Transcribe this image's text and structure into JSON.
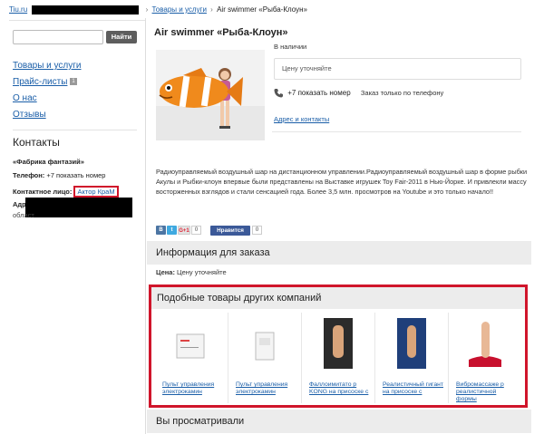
{
  "breadcrumb": {
    "home": "Tiu.ru",
    "category": "Товары и услуги",
    "current": "Air swimmer «Рыба-Клоун»",
    "separator": "›"
  },
  "sidebar": {
    "search": {
      "value": "",
      "placeholder": "",
      "button_label": "Найти"
    },
    "nav": [
      {
        "label": "Товары и услуги"
      },
      {
        "label": "Прайс-листы",
        "count": "1"
      },
      {
        "label": "О нас"
      },
      {
        "label": "Отзывы"
      }
    ],
    "contacts": {
      "title": "Контакты",
      "company": "«Фабрика фантазий»",
      "phone_label": "Телефон:",
      "phone_value": "+7 показать номер",
      "person_label": "Контактное лицо:",
      "person_value": "Актор КраМ",
      "address_label": "Адрес",
      "region": "област"
    }
  },
  "product": {
    "title": "Air swimmer «Рыба-Клоун»",
    "availability": "В наличии",
    "price": "Цену уточняйте",
    "phone": "+7 показать номер",
    "phone_note": "Заказ только по телефону",
    "address_link": "Адрес и контакты",
    "description": "Радиоуправляемый воздушный шар на дистанционном управлении.Радиоуправляемый воздушный шар в форме рыбки Акулы и Рыбки-клоун впервые были представлены на Выставке игрушек Toy Fair-2011 в Нью-Йорке. И привлекли массу восторженных взглядов и стали сенсацией года. Более 3,5 млн. просмотров на Youtube и это только начало!!"
  },
  "social": {
    "vk": "В",
    "twitter": "t",
    "gplus": "G+1",
    "gplus_count": "0",
    "fb_label": "Нравится",
    "fb_count": "0"
  },
  "order_info": {
    "title": "Информация для заказа",
    "price_label": "Цена:",
    "price_value": "Цену уточняйте"
  },
  "similar": {
    "title": "Подобные товары других компаний",
    "items": [
      {
        "name": "Пульт управления электрокамин"
      },
      {
        "name": "Пульт управления электрокамин"
      },
      {
        "name": "Фаллоимитато р KONG на присоске с"
      },
      {
        "name": "Реалистичный гигант на присоске с"
      },
      {
        "name": "Вибромассаже р реалистичной формы"
      }
    ]
  },
  "viewed": {
    "title": "Вы просматривали"
  },
  "colors": {
    "link": "#1a5ea8",
    "highlight": "#d0152b",
    "section_bg": "#ececec"
  }
}
